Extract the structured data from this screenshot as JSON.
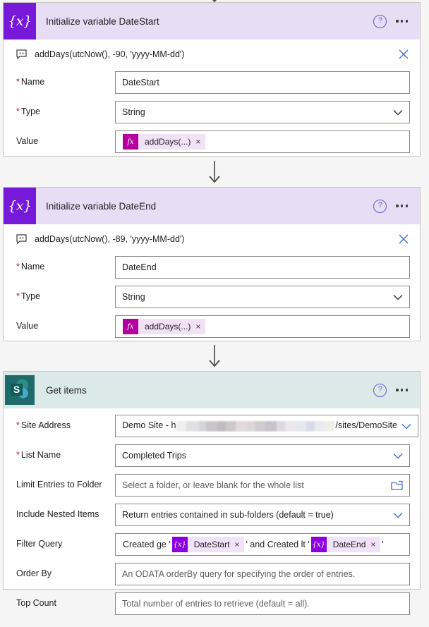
{
  "page": {
    "background": "#f5f5f5",
    "accent_variable": "#7719d8",
    "accent_sharepoint": "#1f6b6b",
    "required_marker": "*"
  },
  "cards": [
    {
      "id": "initialize-variable-datestart",
      "title": "Initialize variable DateStart",
      "icon": "variable-icon",
      "icon_glyph": "{x}",
      "header_color": "#e7ddf5",
      "help_label": "?",
      "comment": {
        "icon": "comment-icon",
        "text": "addDays(utcNow(), -90, 'yyyy-MM-dd')",
        "close_label": "close-icon"
      },
      "fields": [
        {
          "label": "Name",
          "required": true,
          "value": "DateStart",
          "control": "text"
        },
        {
          "label": "Type",
          "required": true,
          "value": "String",
          "control": "dropdown"
        },
        {
          "label": "Value",
          "required": false,
          "control": "token",
          "token": {
            "badge": "fx",
            "label": "addDays(...)",
            "remove": "×"
          }
        }
      ]
    },
    {
      "id": "initialize-variable-dateend",
      "title": "Initialize variable DateEnd",
      "icon": "variable-icon",
      "icon_glyph": "{x}",
      "header_color": "#e7ddf5",
      "help_label": "?",
      "comment": {
        "icon": "comment-icon",
        "text": "addDays(utcNow(), -89, 'yyyy-MM-dd')",
        "close_label": "close-icon"
      },
      "fields": [
        {
          "label": "Name",
          "required": true,
          "value": "DateEnd",
          "control": "text"
        },
        {
          "label": "Type",
          "required": true,
          "value": "String",
          "control": "dropdown"
        },
        {
          "label": "Value",
          "required": false,
          "control": "token",
          "token": {
            "badge": "fx",
            "label": "addDays(...)",
            "remove": "×"
          }
        }
      ]
    }
  ],
  "get_items": {
    "id": "get-items",
    "title": "Get items",
    "icon": "sharepoint-icon",
    "icon_glyph": "S",
    "header_color": "#dce9e9",
    "help_label": "?",
    "fields": {
      "site_address": {
        "label": "Site Address",
        "required": true,
        "value_prefix": "Demo Site - h",
        "value_suffix": "/sites/DemoSite",
        "redacted": true
      },
      "list_name": {
        "label": "List Name",
        "required": true,
        "value": "Completed Trips"
      },
      "limit_entries_to_folder": {
        "label": "Limit Entries to Folder",
        "required": false,
        "placeholder": "Select a folder, or leave blank for the whole list",
        "icon": "folder-picker-icon"
      },
      "include_nested_items": {
        "label": "Include Nested Items",
        "required": false,
        "value": "Return entries contained in sub-folders (default = true)"
      },
      "filter_query": {
        "label": "Filter Query",
        "required": false,
        "segments": [
          {
            "kind": "text",
            "text": "Created ge '"
          },
          {
            "kind": "token",
            "badge": "{x}",
            "label": "DateStart",
            "remove": "×"
          },
          {
            "kind": "text",
            "text": "' and Created lt '"
          },
          {
            "kind": "token",
            "badge": "{x}",
            "label": "DateEnd",
            "remove": "×"
          },
          {
            "kind": "text",
            "text": "'"
          }
        ]
      },
      "order_by": {
        "label": "Order By",
        "required": false,
        "placeholder": "An ODATA orderBy query for specifying the order of entries."
      },
      "top_count": {
        "label": "Top Count",
        "required": false,
        "placeholder": "Total number of entries to retrieve (default = all)."
      }
    }
  }
}
